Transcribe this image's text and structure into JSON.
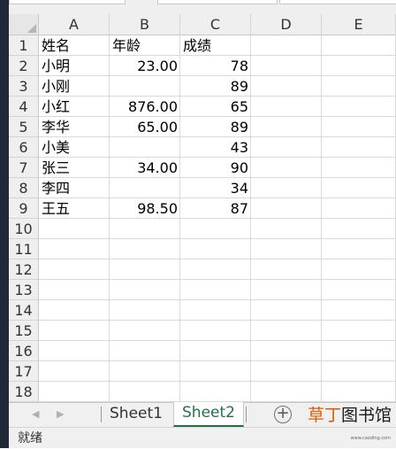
{
  "columns": [
    "A",
    "B",
    "C",
    "D",
    "E"
  ],
  "rows": [
    "1",
    "2",
    "3",
    "4",
    "5",
    "6",
    "7",
    "8",
    "9",
    "10",
    "11",
    "12",
    "13",
    "14",
    "15",
    "16",
    "17",
    "18"
  ],
  "table": [
    {
      "a": "姓名",
      "b": "年龄",
      "c": "成绩"
    },
    {
      "a": "小明",
      "b": "23.00",
      "c": "78"
    },
    {
      "a": "小刚",
      "b": "",
      "c": "89"
    },
    {
      "a": "小红",
      "b": "876.00",
      "c": "65"
    },
    {
      "a": "李华",
      "b": "65.00",
      "c": "89"
    },
    {
      "a": "小美",
      "b": "",
      "c": "43"
    },
    {
      "a": "张三",
      "b": "34.00",
      "c": "90"
    },
    {
      "a": "李四",
      "b": "",
      "c": "34"
    },
    {
      "a": "王五",
      "b": "98.50",
      "c": "87"
    }
  ],
  "sheets": {
    "tab1": "Sheet1",
    "tab2": "Sheet2",
    "active": "Sheet2"
  },
  "add_sheet_symbol": "+",
  "watermark": {
    "part1": "草丁",
    "part2": "图书馆"
  },
  "status": {
    "text": "就绪",
    "tiny": "www.caoding.com"
  },
  "colors": {
    "active_tab": "#217346",
    "watermark_orange": "#e05a00",
    "left_bar": "#1f2937"
  }
}
